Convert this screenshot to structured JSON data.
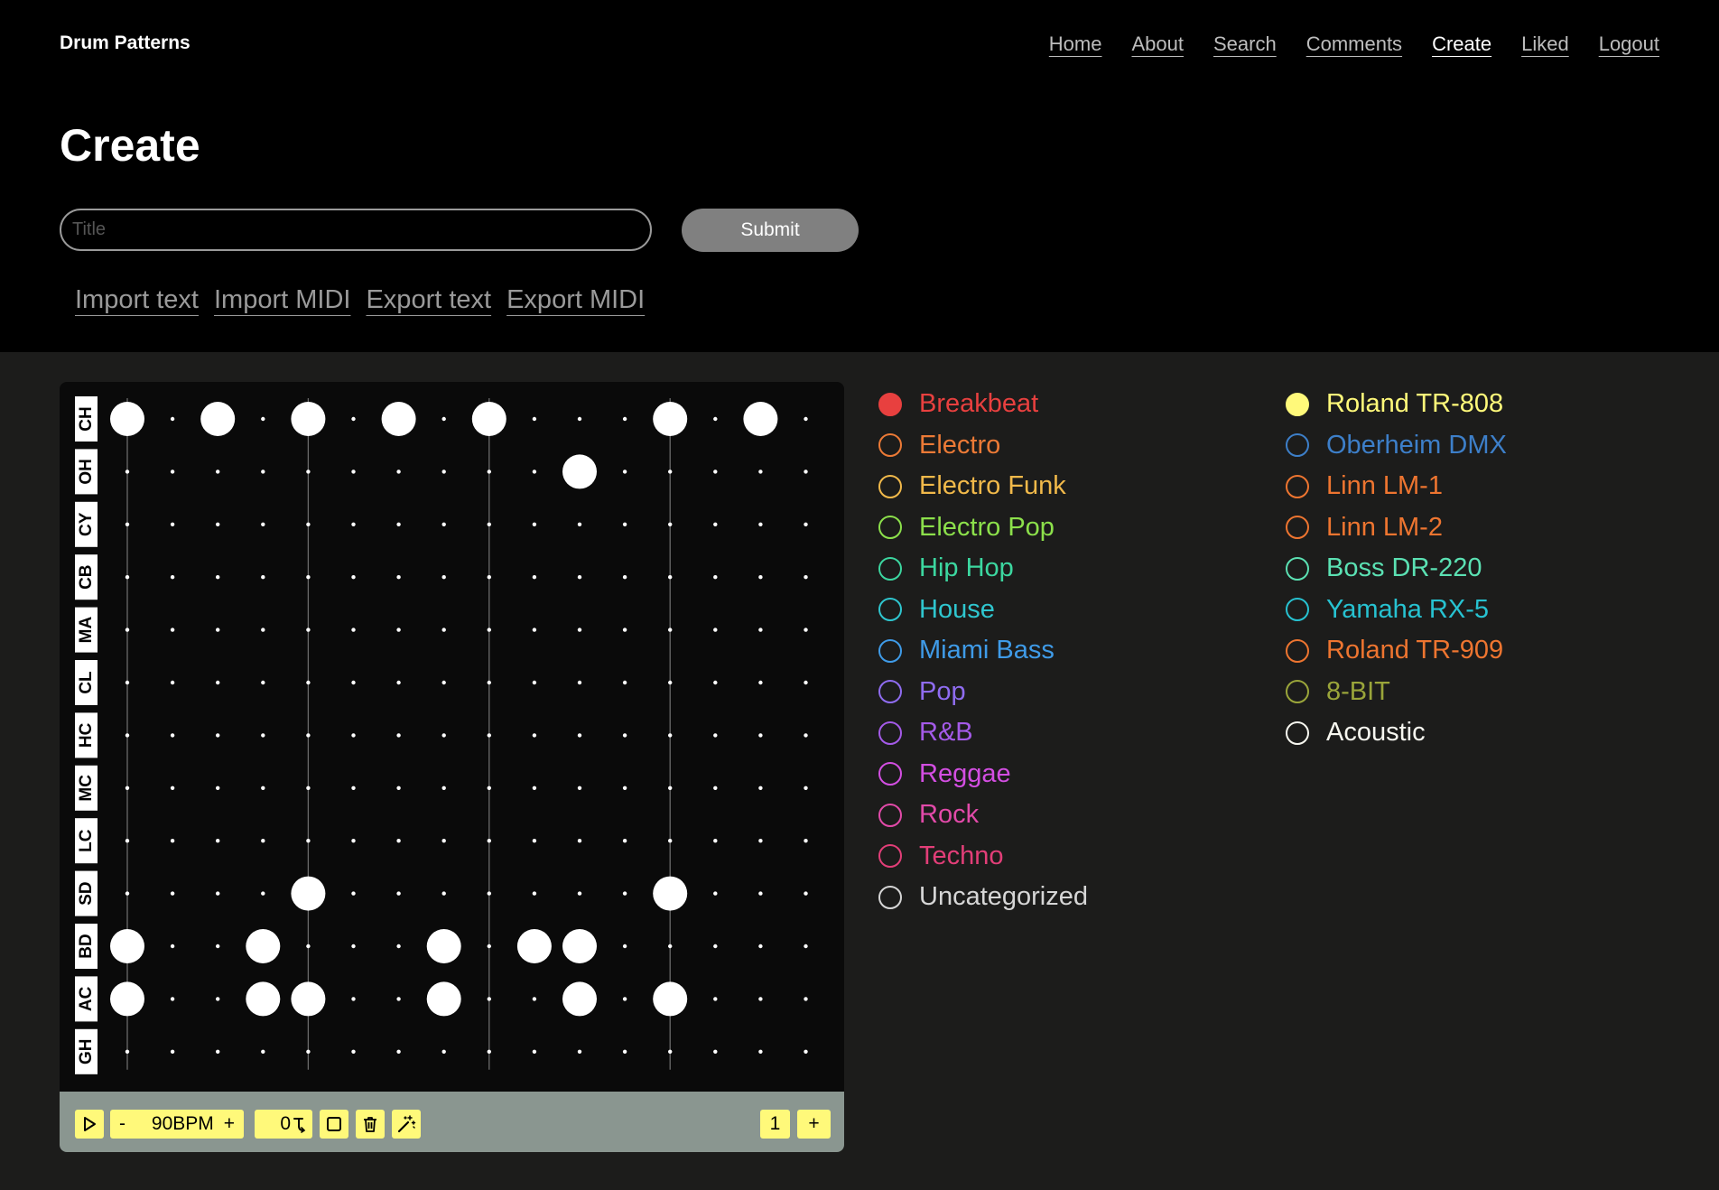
{
  "header": {
    "brand": "Drum Patterns",
    "nav": [
      {
        "label": "Home",
        "name": "nav-home",
        "active": false
      },
      {
        "label": "About",
        "name": "nav-about",
        "active": false
      },
      {
        "label": "Search",
        "name": "nav-search",
        "active": false
      },
      {
        "label": "Comments",
        "name": "nav-comments",
        "active": false
      },
      {
        "label": "Create",
        "name": "nav-create",
        "active": true
      },
      {
        "label": "Liked",
        "name": "nav-liked",
        "active": false
      },
      {
        "label": "Logout",
        "name": "nav-logout",
        "active": false
      }
    ]
  },
  "page": {
    "title": "Create",
    "title_input_value": "",
    "title_input_placeholder": "Title",
    "submit_label": "Submit"
  },
  "tools": [
    {
      "label": "Import text",
      "name": "import-text-link"
    },
    {
      "label": "Import MIDI",
      "name": "import-midi-link"
    },
    {
      "label": "Export text",
      "name": "export-text-link"
    },
    {
      "label": "Export MIDI",
      "name": "export-midi-link"
    }
  ],
  "sequencer": {
    "steps": 16,
    "tracks": [
      {
        "label": "CH",
        "hits": [
          0,
          2,
          4,
          6,
          8,
          12,
          14
        ]
      },
      {
        "label": "OH",
        "hits": [
          10
        ]
      },
      {
        "label": "CY",
        "hits": []
      },
      {
        "label": "CB",
        "hits": []
      },
      {
        "label": "MA",
        "hits": []
      },
      {
        "label": "CL",
        "hits": []
      },
      {
        "label": "HC",
        "hits": []
      },
      {
        "label": "MC",
        "hits": []
      },
      {
        "label": "LC",
        "hits": []
      },
      {
        "label": "SD",
        "hits": [
          4,
          12
        ]
      },
      {
        "label": "BD",
        "hits": [
          0,
          3,
          7,
          9,
          10
        ]
      },
      {
        "label": "AC",
        "hits": [
          0,
          3,
          4,
          7,
          10,
          12
        ]
      },
      {
        "label": "GH",
        "hits": []
      }
    ],
    "controls": {
      "play_icon": "play-icon",
      "bpm_minus": "-",
      "bpm_value": "90BPM",
      "bpm_plus": "+",
      "shift_value": "0",
      "shift_icon": "shift-icon",
      "stop_icon": "square-icon",
      "trash_icon": "trash-icon",
      "magic_icon": "magic-wand-icon",
      "bars_value": "1",
      "add_bar_label": "+"
    }
  },
  "categories_left": [
    {
      "label": "Breakbeat",
      "color": "#e8403f",
      "selected": true
    },
    {
      "label": "Electro",
      "color": "#ec7a36",
      "selected": false
    },
    {
      "label": "Electro Funk",
      "color": "#f1b94a",
      "selected": false
    },
    {
      "label": "Electro Pop",
      "color": "#8ce04b",
      "selected": false
    },
    {
      "label": "Hip Hop",
      "color": "#3cd7a0",
      "selected": false
    },
    {
      "label": "House",
      "color": "#2fc6cf",
      "selected": false
    },
    {
      "label": "Miami Bass",
      "color": "#3f9be8",
      "selected": false
    },
    {
      "label": "Pop",
      "color": "#8f6cf0",
      "selected": false
    },
    {
      "label": "R&B",
      "color": "#a45ae8",
      "selected": false
    },
    {
      "label": "Reggae",
      "color": "#d34ee2",
      "selected": false
    },
    {
      "label": "Rock",
      "color": "#e24aa9",
      "selected": false
    },
    {
      "label": "Techno",
      "color": "#e23e78",
      "selected": false
    },
    {
      "label": "Uncategorized",
      "color": "#d6d6d6",
      "selected": false
    }
  ],
  "categories_right": [
    {
      "label": "Roland TR-808",
      "color": "#fff97a",
      "selected": true
    },
    {
      "label": "Oberheim DMX",
      "color": "#3d7fc9",
      "selected": false
    },
    {
      "label": "Linn LM-1",
      "color": "#ee7530",
      "selected": false
    },
    {
      "label": "Linn LM-2",
      "color": "#ee7530",
      "selected": false
    },
    {
      "label": "Boss DR-220",
      "color": "#5be1b3",
      "selected": false
    },
    {
      "label": "Yamaha RX-5",
      "color": "#27c2d1",
      "selected": false
    },
    {
      "label": "Roland TR-909",
      "color": "#ee7530",
      "selected": false
    },
    {
      "label": "8-BIT",
      "color": "#9aa53a",
      "selected": false
    },
    {
      "label": "Acoustic",
      "color": "#f7f7f0",
      "selected": false
    }
  ]
}
